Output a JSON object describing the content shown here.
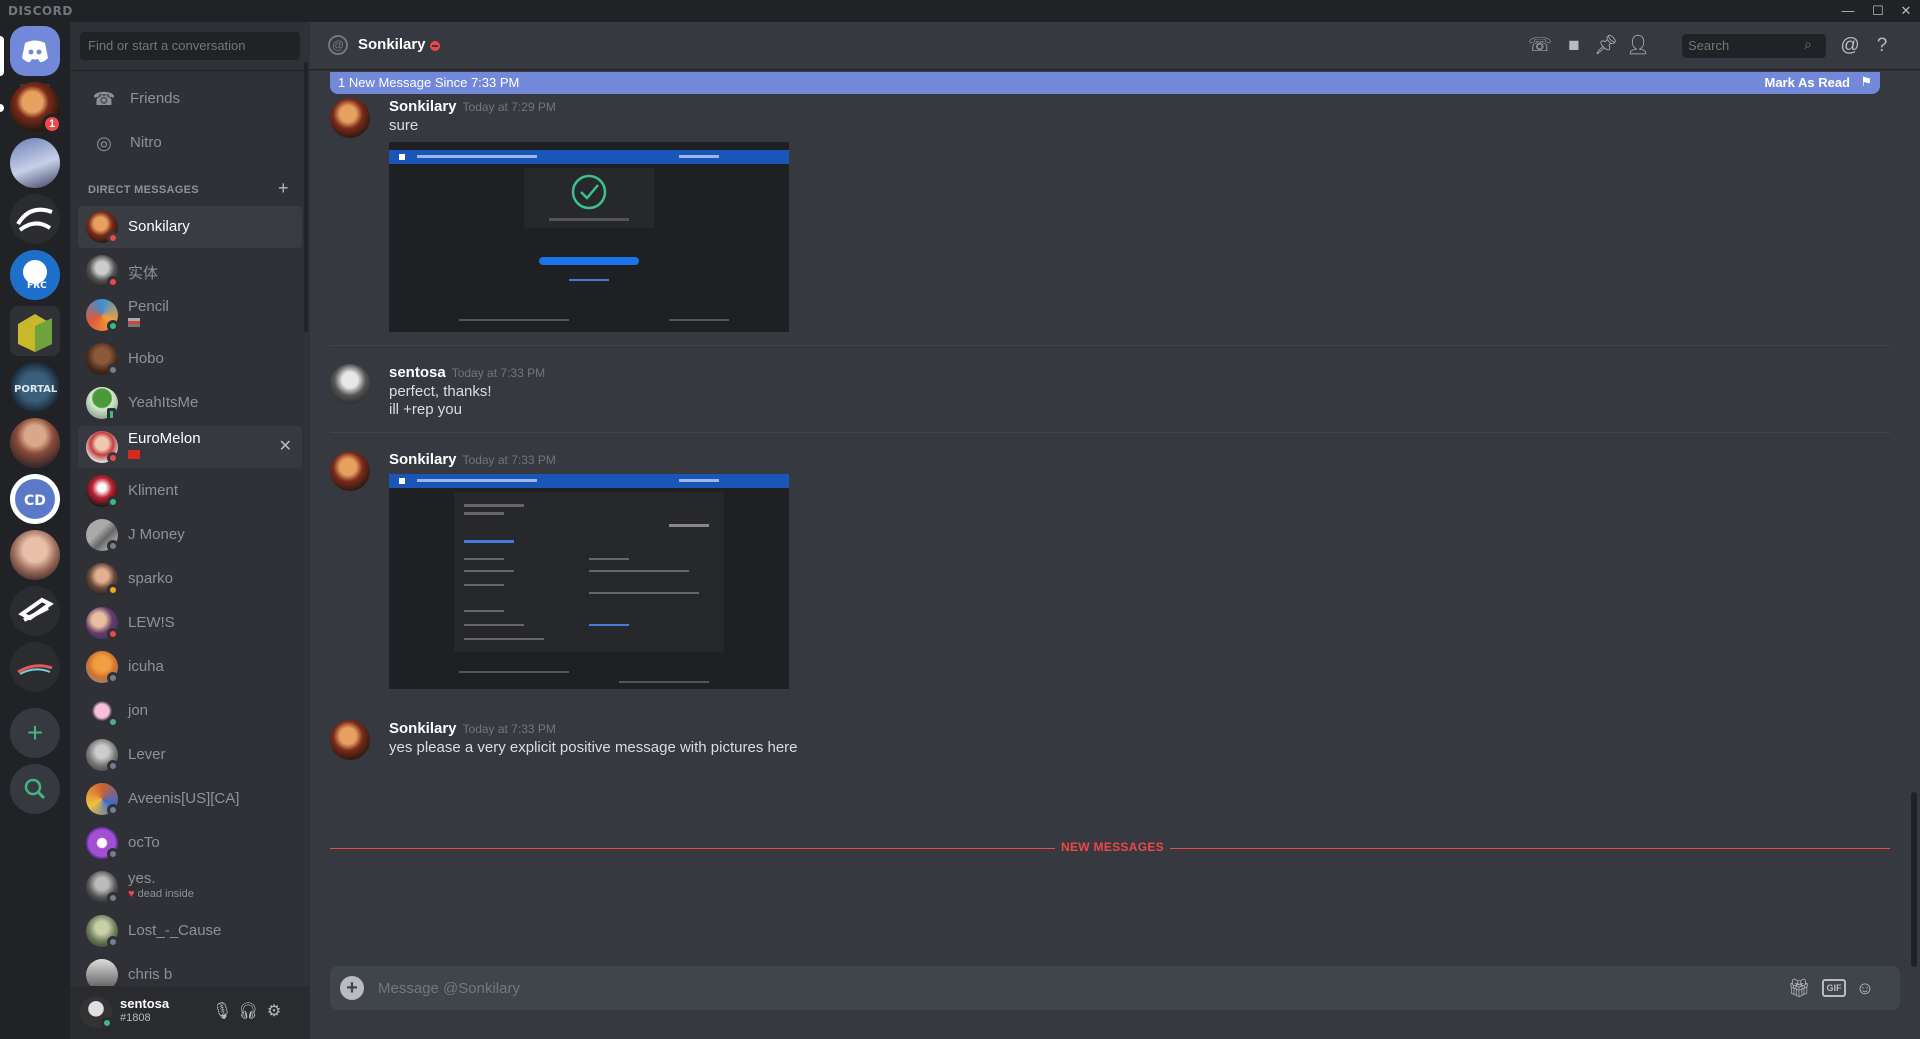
{
  "app": {
    "brand": "DISCORD"
  },
  "window": {
    "minimize": "—",
    "maximize": "☐",
    "close": "✕"
  },
  "sidebar": {
    "search_placeholder": "Find or start a conversation",
    "nav": [
      {
        "label": "Friends",
        "icon": "friends-icon"
      },
      {
        "label": "Nitro",
        "icon": "nitro-icon"
      }
    ],
    "dm_header": "DIRECT MESSAGES",
    "dms": [
      {
        "name": "Sonkilary",
        "status": "dnd",
        "selected": true
      },
      {
        "name": "实体",
        "status": "dnd"
      },
      {
        "name": "Pencil",
        "status": "online",
        "sub_flag": true
      },
      {
        "name": "Hobo",
        "status": "offline"
      },
      {
        "name": "YeahItsMe",
        "status": "mobile"
      },
      {
        "name": "EuroMelon",
        "status": "dnd",
        "sub_flag": true,
        "hovered": true
      },
      {
        "name": "Kliment",
        "status": "online"
      },
      {
        "name": "J Money",
        "status": "offline"
      },
      {
        "name": "sparko",
        "status": "idle"
      },
      {
        "name": "LEW!S",
        "status": "dnd"
      },
      {
        "name": "icuha",
        "status": "offline"
      },
      {
        "name": "jon",
        "status": "online"
      },
      {
        "name": "Lever",
        "status": "offline"
      },
      {
        "name": "Aveenis[US][CA]",
        "status": "offline"
      },
      {
        "name": "ocTo",
        "status": "offline"
      },
      {
        "name": "yes.",
        "status": "offline",
        "sub": "dead inside"
      },
      {
        "name": "Lost_-_Cause",
        "status": "offline"
      },
      {
        "name": "chris b",
        "status": "offline"
      }
    ]
  },
  "servers": {
    "home_unread_badge": "1"
  },
  "user": {
    "name": "sentosa",
    "tag": "#1808"
  },
  "header": {
    "channel": "Sonkilary",
    "search_placeholder": "Search"
  },
  "new_bar": {
    "text": "1 New Message Since 7:33 PM",
    "action": "Mark As Read"
  },
  "messages": [
    {
      "author": "Sonkilary",
      "time": "Today at 7:29 PM",
      "lines": [
        "sure"
      ],
      "attachment": "paypal-confirmation-screenshot"
    },
    {
      "author": "sentosa",
      "time": "Today at 7:33 PM",
      "lines": [
        "perfect, thanks!",
        "ill +rep you"
      ]
    },
    {
      "author": "Sonkilary",
      "time": "Today at 7:33 PM",
      "lines": [],
      "attachment": "paypal-transaction-details-screenshot"
    },
    {
      "author": "Sonkilary",
      "time": "Today at 7:33 PM",
      "lines": [
        "yes please a very explicit positive message with pictures here"
      ]
    }
  ],
  "divider": "NEW MESSAGES",
  "composer": {
    "placeholder": "Message @Sonkilary",
    "gif": "GIF"
  },
  "colors": {
    "blurple": "#7289da",
    "dnd": "#f04747",
    "online": "#43b581",
    "idle": "#faa61a",
    "offline": "#747f8d",
    "bg": "#36393f"
  }
}
